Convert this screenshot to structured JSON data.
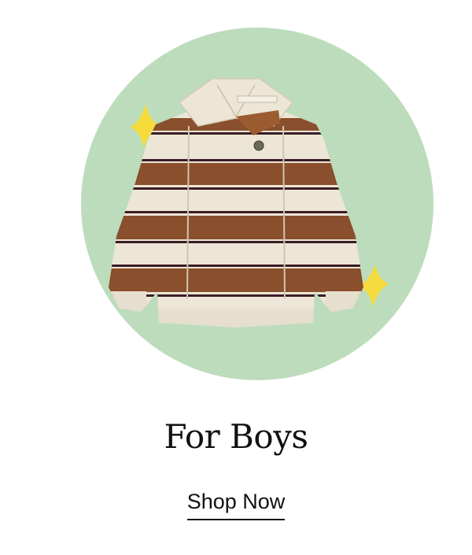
{
  "card": {
    "title": "For Boys",
    "cta_label": "Shop Now"
  },
  "image": {
    "subject": "striped-knit-sweater",
    "circle_color": "#bcdcbc",
    "sparkle_color": "#f5dc3c",
    "sweater_cream": "#ede6d6",
    "sweater_brown": "#8a4f2c",
    "sweater_stripe": "#3a1c26"
  }
}
